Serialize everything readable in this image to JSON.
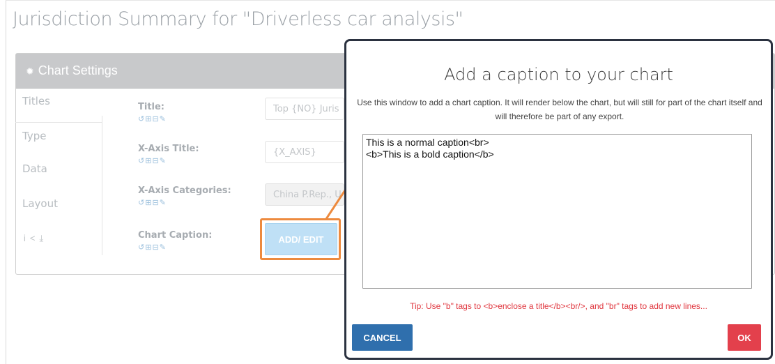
{
  "page": {
    "title": "Jurisdiction Summary for \"Driverless car analysis\""
  },
  "chart_settings": {
    "header": "Chart Settings",
    "tabs": [
      {
        "label": "Titles"
      },
      {
        "label": "Type"
      },
      {
        "label": "Data"
      },
      {
        "label": "Layout"
      }
    ],
    "side_icons": [
      "info-icon",
      "share-icon",
      "download-icon"
    ],
    "fields": [
      {
        "label": "Title:",
        "value": "Top {NO} Juris"
      },
      {
        "label": "X-Axis Title:",
        "value": "{X_AXIS}"
      },
      {
        "label": "X-Axis Categories:",
        "value": "China P.Rep., U"
      },
      {
        "label": "Chart Caption:",
        "button": "ADD/ EDIT"
      }
    ],
    "field_tools": [
      "undo-icon",
      "expand-icon",
      "collapse-icon",
      "brush-icon"
    ]
  },
  "modal": {
    "title": "Add a caption to your chart",
    "description": "Use this window to add a chart caption. It will render below the chart, but will still for part of the chart itself and will therefore be part of any export.",
    "textarea_value": "This is a normal caption<br>\n<b>This is a bold caption</b>",
    "tip": "Tip: Use \"b\" tags to <b>enclose a title</b><br/>, and \"br\" tags to add new lines...",
    "cancel_label": "CANCEL",
    "ok_label": "OK"
  },
  "colors": {
    "highlight": "#ed8a3e",
    "cancel": "#2f6fad",
    "ok": "#e3404c",
    "tip": "#e0373f"
  }
}
